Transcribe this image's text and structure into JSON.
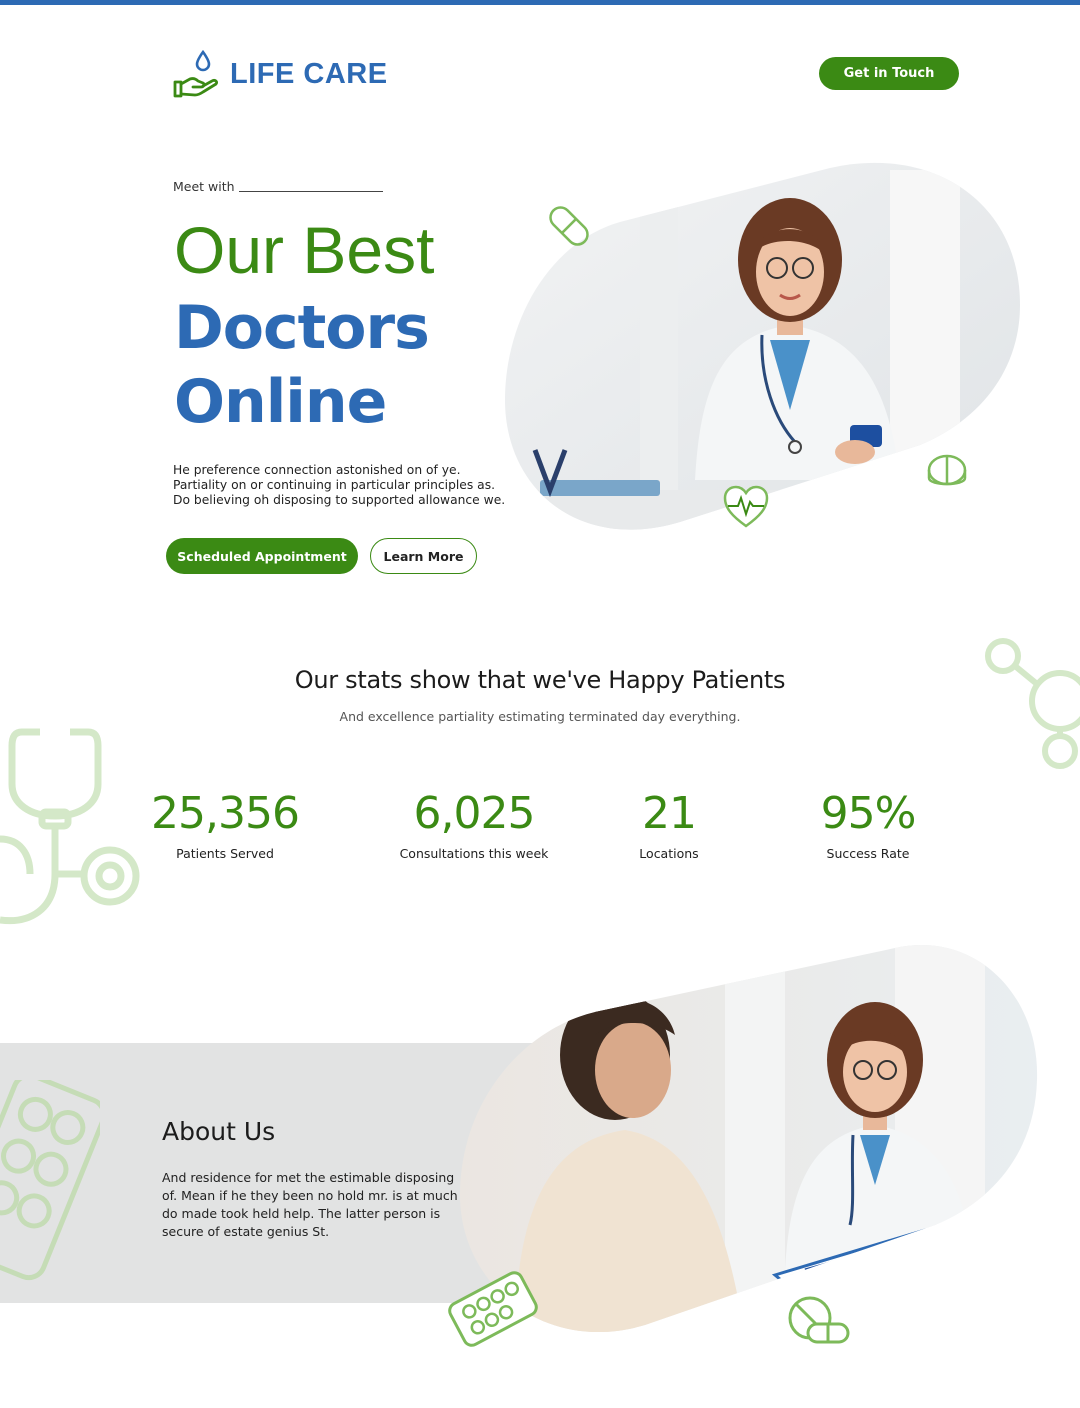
{
  "brand": {
    "name": "LIFE CARE",
    "color": "#2d6ab4",
    "accent": "#3b8a14"
  },
  "header": {
    "cta_label": "Get in Touch"
  },
  "hero": {
    "eyebrow": "Meet with",
    "title_line1": "Our Best",
    "title_line2": "Doctors",
    "title_line3": "Online",
    "description": "He preference connection astonished on of ye. Partiality on or continuing in particular principles as. Do believing oh disposing to supported allowance we.",
    "primary_button": "Scheduled Appointment",
    "secondary_button": "Learn More",
    "image_icon": "doctor-photo"
  },
  "stats": {
    "title": "Our stats show that we've Happy Patients",
    "subtitle": "And excellence partiality estimating terminated day everything.",
    "items": [
      {
        "value": "25,356",
        "label": "Patients Served"
      },
      {
        "value": "6,025",
        "label": "Consultations this week"
      },
      {
        "value": "21",
        "label": "Locations"
      },
      {
        "value": "95%",
        "label": "Success Rate"
      }
    ]
  },
  "about": {
    "title": "About Us",
    "description": "And residence for met the estimable disposing of. Mean if he they been no hold mr. is at much do made took held help. The latter person is secure of estate genius St.",
    "image_icon": "consultation-photo"
  },
  "decor_icons": [
    "capsule-icon",
    "pill-half-icon",
    "heart-pulse-icon",
    "molecule-icon",
    "stethoscope-icon",
    "pill-blister-icon",
    "pills-icon"
  ]
}
